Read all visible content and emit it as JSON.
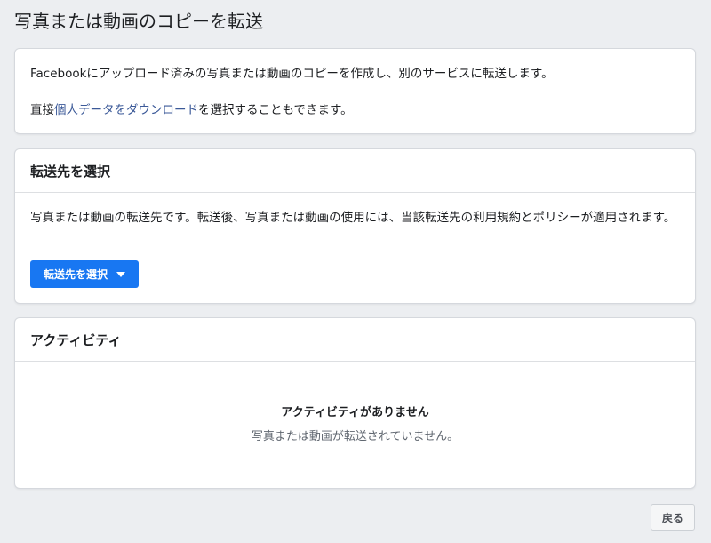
{
  "page": {
    "title": "写真または動画のコピーを転送"
  },
  "intro": {
    "line1": "Facebookにアップロード済みの写真または動画のコピーを作成し、別のサービスに転送します。",
    "line2_prefix": "直接",
    "line2_link": "個人データをダウンロード",
    "line2_suffix": "を選択することもできます。"
  },
  "destination": {
    "header": "転送先を選択",
    "description": "写真または動画の転送先です。転送後、写真または動画の使用には、当該転送先の利用規約とポリシーが適用されます。",
    "button_label": "転送先を選択"
  },
  "activity": {
    "header": "アクティビティ",
    "empty_title": "アクティビティがありません",
    "empty_subtitle": "写真または動画が転送されていません。"
  },
  "footer": {
    "back_label": "戻る"
  },
  "colors": {
    "accent": "#1877f2",
    "link": "#3b5998",
    "background": "#eceef1"
  }
}
